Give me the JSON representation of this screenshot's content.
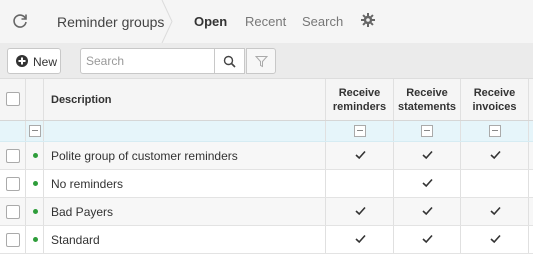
{
  "nav": {
    "title": "Reminder groups",
    "tabs": [
      {
        "label": "Open",
        "active": true
      },
      {
        "label": "Recent",
        "active": false
      },
      {
        "label": "Search",
        "active": false
      }
    ]
  },
  "toolbar": {
    "new_label": "New",
    "search_placeholder": "Search",
    "search_value": ""
  },
  "table": {
    "columns": [
      "Description",
      "Receive reminders",
      "Receive statements",
      "Receive invoices"
    ],
    "header_lines": {
      "description": "Description",
      "reminders": [
        "Receive",
        "reminders"
      ],
      "statements": [
        "Receive",
        "statements"
      ],
      "invoices": [
        "Receive",
        "invoices"
      ]
    },
    "rows": [
      {
        "description": "Polite group of customer reminders",
        "receive_reminders": true,
        "receive_statements": true,
        "receive_invoices": true
      },
      {
        "description": "No reminders",
        "receive_reminders": false,
        "receive_statements": true,
        "receive_invoices": false
      },
      {
        "description": "Bad Payers",
        "receive_reminders": true,
        "receive_statements": true,
        "receive_invoices": true
      },
      {
        "description": "Standard",
        "receive_reminders": true,
        "receive_statements": true,
        "receive_invoices": true
      }
    ]
  },
  "colors": {
    "status_dot": "#2e9d3a",
    "filter_row": "#e6f5fa"
  },
  "icons": {
    "refresh": "refresh-icon",
    "settings": "gear-icon",
    "new": "plus-circle-icon",
    "search": "search-icon",
    "filter": "filter-icon",
    "check": "checkmark-icon"
  }
}
